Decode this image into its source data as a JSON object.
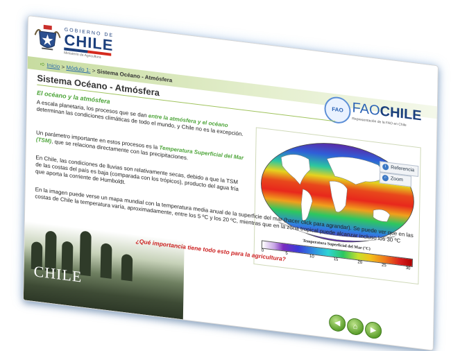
{
  "header": {
    "gob_top": "GOBIERNO DE",
    "gob_name": "CHILE",
    "gob_ministry": "Ministerio de Agricultura"
  },
  "breadcrumb": {
    "home": "Inicio",
    "sep1": " > ",
    "module": "Módulo 1:",
    "sep2": " > ",
    "current": "Sistema Océano - Atmósfera"
  },
  "fao": {
    "emblem": "FAO",
    "word_a": "FAO",
    "word_b": "CHILE",
    "subtitle": "Representación de la FAO en Chile"
  },
  "page": {
    "title": "Sistema Océano - Atmósfera",
    "section_heading": "El océano y la atmósfera",
    "p1_a": "A escala planetaria, los procesos que se dan ",
    "p1_hl": "entre la atmósfera y el océano",
    "p1_b": " determinan las condiciones climáticas de todo el mundo, y Chile no es la excepción.",
    "p2_a": "Un parámetro importante en estos procesos es la ",
    "p2_hl": "Temperatura Superficial del Mar (TSM)",
    "p2_b": ", que se relaciona directamente con las precipitaciones.",
    "p3": "En Chile, las condiciones de lluvias son relativamente secas, debido a que la TSM de las costas del país es baja (comparada con los trópicos), producto del agua fría que aporta la corriente de Humboldt.",
    "p4": "En la imagen puede verse un mapa mundial con la temperatura media anual de la superficie del mar (hacer click para agrandar). Se puede ver que en las costas de Chile la temperatura varía, aproximadamente, entre los 5 ºC y los 20 ºC, mientras que en la zona tropical puede alcanzar incluso los 30 ºC",
    "question": "¿Qué importancia tiene todo esto para la agricultura?"
  },
  "map": {
    "caption": "Temperatura Superficial del Mar (°C)",
    "scale_labels": [
      "0",
      "5",
      "10",
      "15",
      "20",
      "25",
      "30"
    ],
    "referencia_label": "Referencia",
    "zoom_label": "Zoom"
  },
  "footer": {
    "brand": "CHILE"
  },
  "nav": {
    "prev_icon": "arrow-left-icon",
    "home_icon": "home-icon",
    "next_icon": "arrow-right-icon"
  },
  "colors": {
    "accent_green": "#4ea53a",
    "link_blue": "#2b6aa8",
    "question_red": "#cc2222",
    "fao_blue": "#2b63b5"
  }
}
